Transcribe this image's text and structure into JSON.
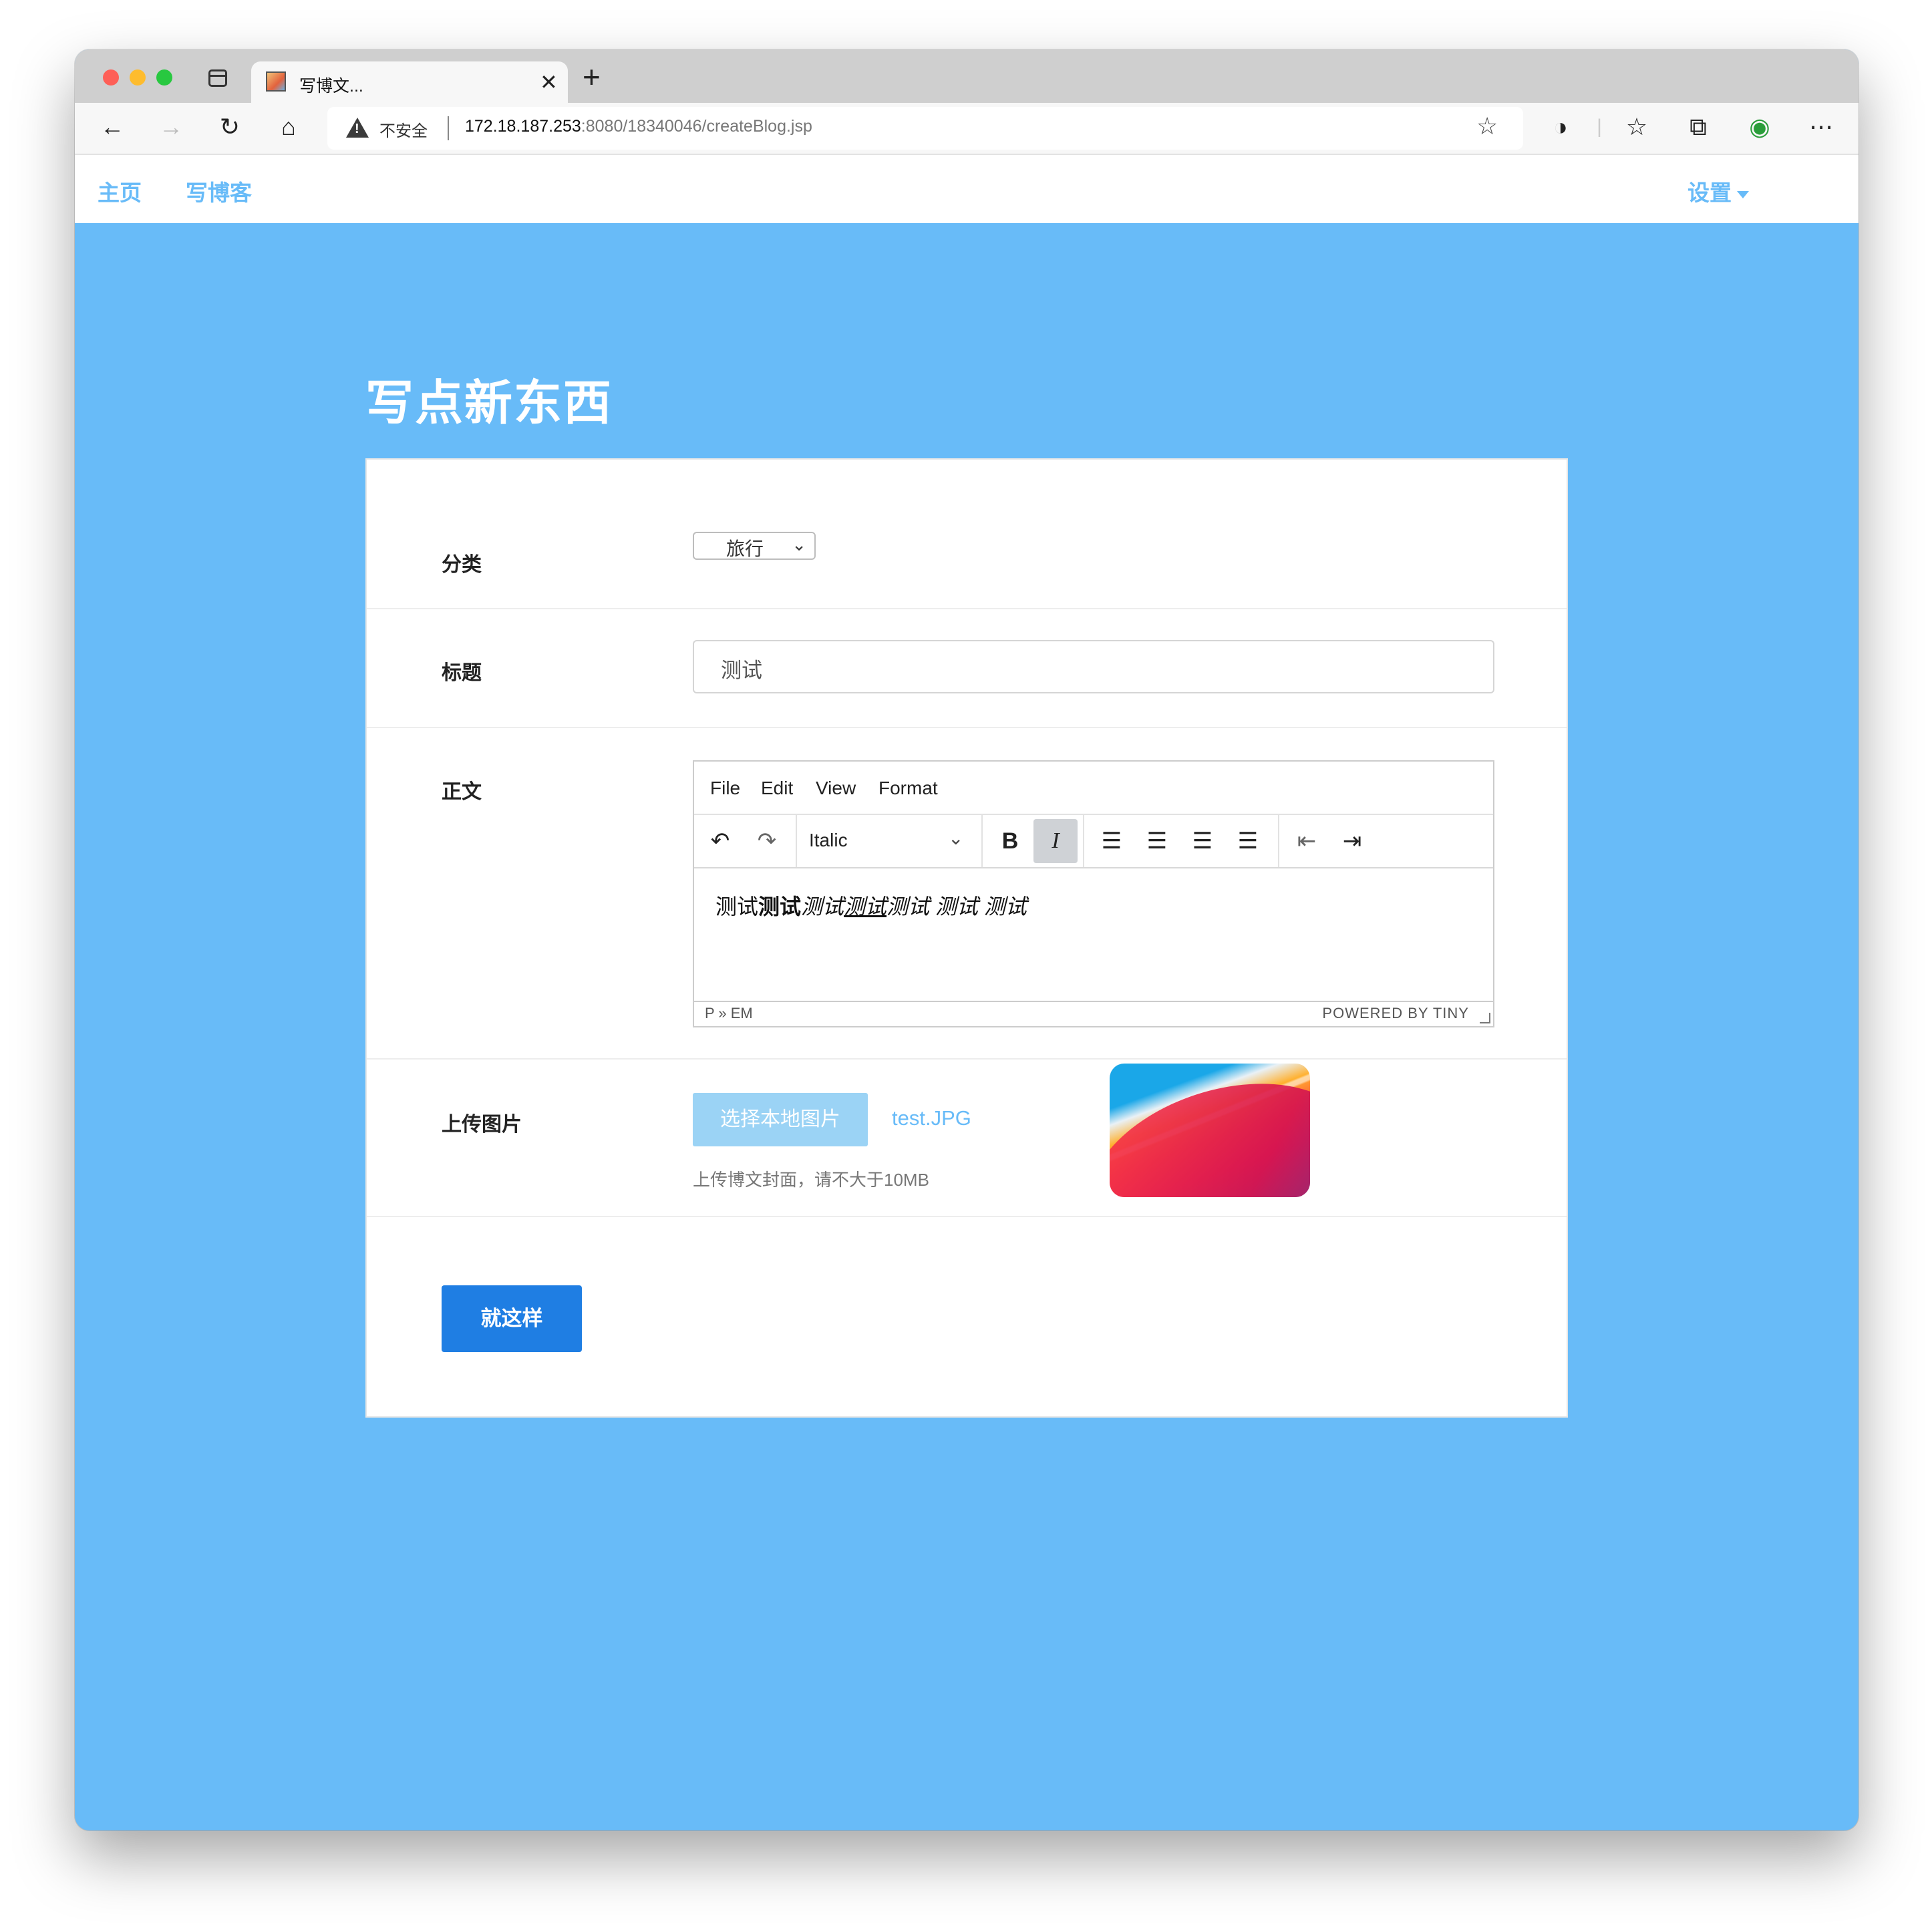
{
  "browser": {
    "tab_title": "写博文...",
    "security_label": "不安全",
    "url_host": "172.18.187.253",
    "url_rest": ":8080/18340046/createBlog.jsp"
  },
  "nav": {
    "home": "主页",
    "write": "写博客",
    "settings": "设置"
  },
  "page": {
    "heading": "写点新东西"
  },
  "form": {
    "category_label": "分类",
    "category_value": "旅行",
    "title_label": "标题",
    "title_value": "测试",
    "body_label": "正文",
    "upload_label": "上传图片",
    "upload_button": "选择本地图片",
    "file_name": "test.JPG",
    "upload_hint": "上传博文封面，请不大于10MB",
    "submit_label": "就这样"
  },
  "editor": {
    "menus": [
      "File",
      "Edit",
      "View",
      "Format"
    ],
    "format_select": "Italic",
    "content": {
      "plain": "测试",
      "bold": "测试",
      "italic1": "测试",
      "italic_underlined": "测试",
      "italic2": "测试",
      "italic3": "测试",
      "italic4": "测试"
    },
    "status_path": "P » EM",
    "powered": "POWERED BY TINY"
  },
  "icons": {
    "undo": "undo-icon",
    "redo": "redo-icon",
    "bold": "bold-icon",
    "italic": "italic-icon",
    "align_left": "align-left-icon",
    "align_center": "align-center-icon",
    "align_right": "align-right-icon",
    "align_justify": "align-justify-icon",
    "outdent": "outdent-icon",
    "indent": "indent-icon"
  },
  "colors": {
    "page_background": "#68bbf8",
    "primary_button": "#1f7ee3",
    "link": "#68bbf8"
  }
}
